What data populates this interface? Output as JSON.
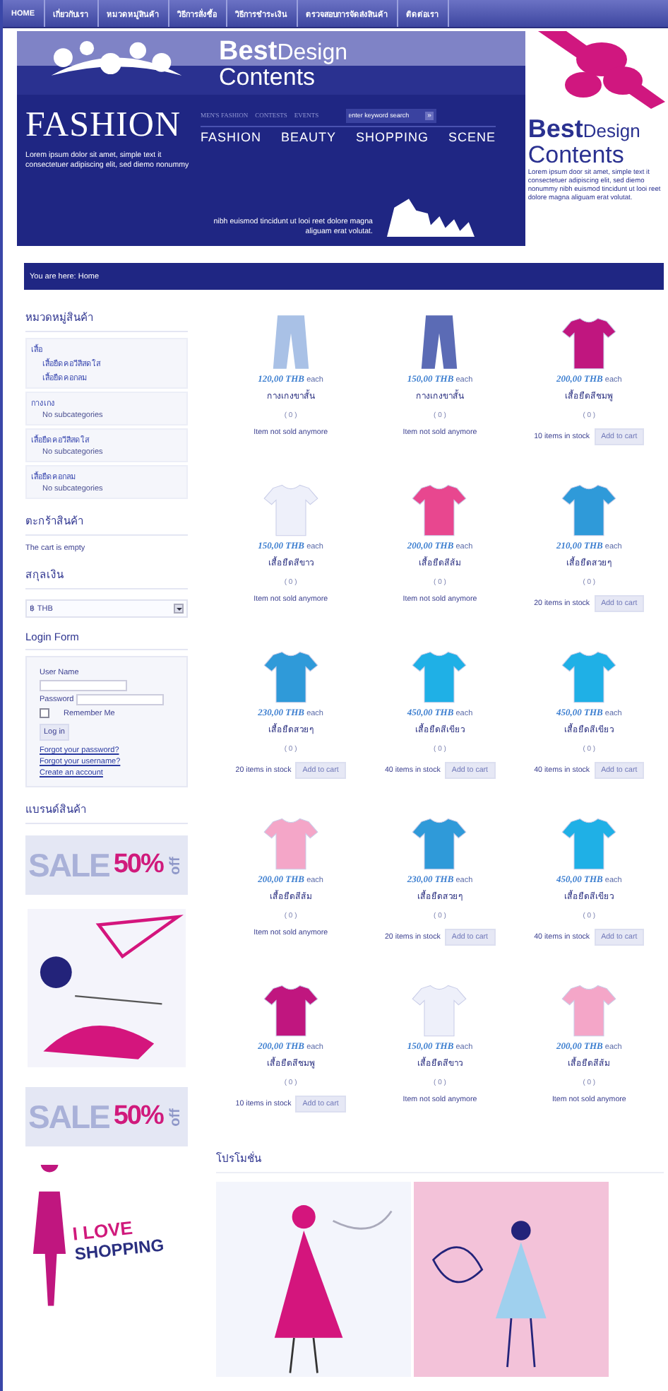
{
  "nav": [
    "HOME",
    "เกี่ยวกับเรา",
    "หมวดหมู่สินค้า",
    "วิธีการสั่งซื้อ",
    "วิธีการชำระเงิน",
    "ตรวจสอบการจัดส่งสินค้า",
    "ติดต่อเรา"
  ],
  "header": {
    "logo_bold": "Best",
    "logo_light": "Design",
    "logo_line2": "Contents",
    "title": "FASHION",
    "subnav": [
      "MEN'S FASHION",
      "CONTESTS",
      "EVENTS"
    ],
    "search": {
      "placeholder": "enter keyword search",
      "button": "»"
    },
    "menu": [
      "FASHION",
      "BEAUTY",
      "SHOPPING",
      "SCENE"
    ],
    "text_left": "Lorem ipsum dolor sit amet, simple text it consectetuer adipiscing  elit, sed diemo nonummy",
    "text_center": "nibh euismod tincidunt ut looi reet dolore magna aliguam erat volutat.",
    "side_logo_bold": "Best",
    "side_logo_light": "Design",
    "side_logo_line2": "Contents",
    "side_text": "Lorem ipsum door sit amet, simple text it consectetuer adipiscing  elit, sed diemo nonummy nibh euismod tincidunt ut looi reet dolore magna aliguam erat volutat."
  },
  "breadcrumb": "You are here:  Home",
  "sidebar": {
    "categories_title": "หมวดหมู่สินค้า",
    "categories": [
      {
        "label": "เสื้อ",
        "children": [
          {
            "label": "เสื้อยืดคอวีสีสดใส"
          },
          {
            "label": "เสื้อยืดคอกลม"
          }
        ]
      },
      {
        "label": "กางเกง",
        "note": "No subcategories"
      },
      {
        "label": "เสื้อยืดคอวีสีสดใส",
        "note": "No subcategories"
      },
      {
        "label": "เสื้อยืดคอกลม",
        "note": "No subcategories"
      }
    ],
    "cart_title": "ตะกร้าสินค้า",
    "cart_text": "The cart is empty",
    "currency_title": "สกุลเงิน",
    "currency_value": "฿ THB",
    "login": {
      "title": "Login Form",
      "username_label": "User Name",
      "password_label": "Password",
      "remember_label": "Remember Me",
      "remember_checked": false,
      "button": "Log in",
      "links": [
        "Forgot your password?",
        "Forgot your username?",
        "Create an account"
      ]
    },
    "brands_title": "แบรนด์สินค้า",
    "brands": [
      {
        "kind": "sale",
        "big": "SALE",
        "percent": "50%",
        "off": "off"
      },
      {
        "kind": "illustration"
      },
      {
        "kind": "sale",
        "big": "SALE",
        "percent": "50%",
        "off": "off"
      },
      {
        "kind": "shopping",
        "line1": "I LOVE",
        "line2": "SHOPPING"
      }
    ]
  },
  "products": [
    {
      "kind": "pants",
      "color": "#a9c1e6",
      "price": "120,00 THB",
      "unit": "each",
      "name": "กางเกงขาสั้น",
      "rating": "( 0 )",
      "stock": "Item not sold anymore"
    },
    {
      "kind": "pants",
      "color": "#5b6bb5",
      "price": "150,00 THB",
      "unit": "each",
      "name": "กางเกงขาสั้น",
      "rating": "( 0 )",
      "stock": "Item not sold anymore"
    },
    {
      "kind": "tshirt",
      "color": "#c0167f",
      "price": "200,00 THB",
      "unit": "each",
      "name": "เสื้อยืดสีชมพู",
      "rating": "( 0 )",
      "stock": "10 items in stock",
      "button": "Add to cart"
    },
    {
      "kind": "tshirt",
      "color": "#eef0fa",
      "price": "150,00 THB",
      "unit": "each",
      "name": "เสื้อยืดสีขาว",
      "rating": "( 0 )",
      "stock": "Item not sold anymore"
    },
    {
      "kind": "tshirt",
      "color": "#e8478f",
      "price": "200,00 THB",
      "unit": "each",
      "name": "เสื้อยืดสีส้ม",
      "rating": "( 0 )",
      "stock": "Item not sold anymore"
    },
    {
      "kind": "tshirt",
      "color": "#2f9ad9",
      "price": "210,00 THB",
      "unit": "each",
      "name": "เสื้อยืดสวยๆ",
      "rating": "( 0 )",
      "stock": "20 items in stock",
      "button": "Add to cart"
    },
    {
      "kind": "tshirt",
      "color": "#2f9ad9",
      "price": "230,00 THB",
      "unit": "each",
      "name": "เสื้อยืดสวยๆ",
      "rating": "( 0 )",
      "stock": "20 items in stock",
      "button": "Add to cart"
    },
    {
      "kind": "tshirt",
      "color": "#1fb0e6",
      "price": "450,00 THB",
      "unit": "each",
      "name": "เสื้อยืดสีเขียว",
      "rating": "( 0 )",
      "stock": "40 items in stock",
      "button": "Add to cart"
    },
    {
      "kind": "tshirt",
      "color": "#1fb0e6",
      "price": "450,00 THB",
      "unit": "each",
      "name": "เสื้อยืดสีเขียว",
      "rating": "( 0 )",
      "stock": "40 items in stock",
      "button": "Add to cart"
    },
    {
      "kind": "tshirt",
      "color": "#f4a6c8",
      "price": "200,00 THB",
      "unit": "each",
      "name": "เสื้อยืดสีส้ม",
      "rating": "( 0 )",
      "stock": "Item not sold anymore"
    },
    {
      "kind": "tshirt",
      "color": "#2f9ad9",
      "price": "230,00 THB",
      "unit": "each",
      "name": "เสื้อยืดสวยๆ",
      "rating": "( 0 )",
      "stock": "20 items in stock",
      "button": "Add to cart"
    },
    {
      "kind": "tshirt",
      "color": "#1fb0e6",
      "price": "450,00 THB",
      "unit": "each",
      "name": "เสื้อยืดสีเขียว",
      "rating": "( 0 )",
      "stock": "40 items in stock",
      "button": "Add to cart"
    },
    {
      "kind": "tshirt",
      "color": "#c0167f",
      "price": "200,00 THB",
      "unit": "each",
      "name": "เสื้อยืดสีชมพู",
      "rating": "( 0 )",
      "stock": "10 items in stock",
      "button": "Add to cart"
    },
    {
      "kind": "tshirt",
      "color": "#eef0fa",
      "price": "150,00 THB",
      "unit": "each",
      "name": "เสื้อยืดสีขาว",
      "rating": "( 0 )",
      "stock": "Item not sold anymore"
    },
    {
      "kind": "tshirt",
      "color": "#f4a6c8",
      "price": "200,00 THB",
      "unit": "each",
      "name": "เสื้อยืดสีส้ม",
      "rating": "( 0 )",
      "stock": "Item not sold anymore"
    }
  ],
  "promo_title": "โปรโมชั่น"
}
